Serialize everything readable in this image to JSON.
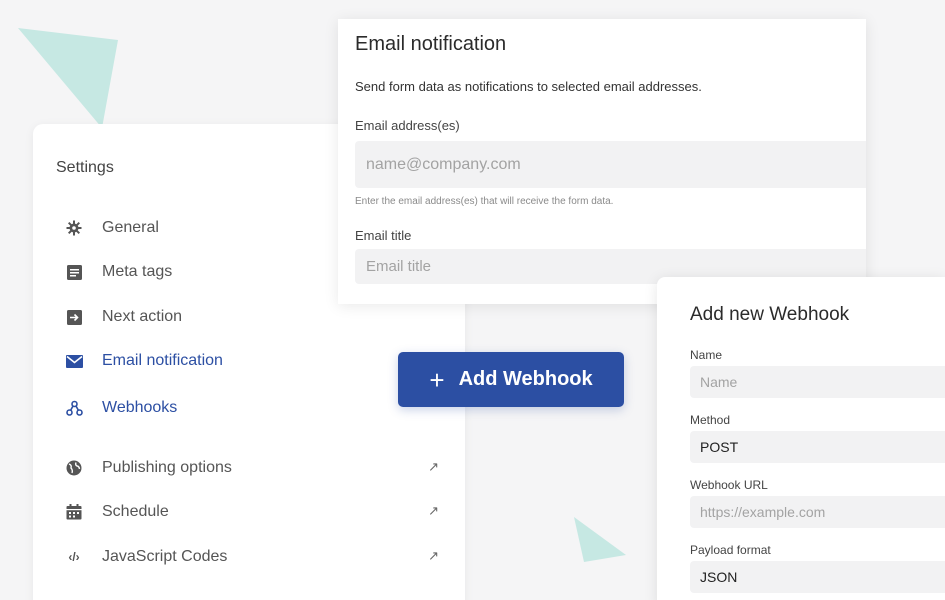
{
  "settings": {
    "title": "Settings",
    "items": [
      {
        "label": "General",
        "icon": "gear-icon"
      },
      {
        "label": "Meta tags",
        "icon": "document-icon"
      },
      {
        "label": "Next action",
        "icon": "arrow-right-box-icon"
      },
      {
        "label": "Email notification",
        "icon": "envelope-icon",
        "active": true
      },
      {
        "label": "Webhooks",
        "icon": "webhook-icon",
        "active": true
      },
      {
        "label": "Publishing options",
        "icon": "globe-icon",
        "external": "↗"
      },
      {
        "label": "Schedule",
        "icon": "calendar-icon",
        "external": "↗"
      },
      {
        "label": "JavaScript Codes",
        "icon": "code-icon",
        "icon_text": "‹/›",
        "external": "↗"
      }
    ]
  },
  "email": {
    "title": "Email notification",
    "description": "Send form data as notifications to selected email addresses.",
    "address_label": "Email address(es)",
    "address_placeholder": "name@company.com",
    "address_hint": "Enter the email address(es) that will receive the form data.",
    "title_label": "Email title",
    "title_placeholder": "Email title"
  },
  "add_button": {
    "plus": "+",
    "label": "Add Webhook"
  },
  "webhook": {
    "title": "Add new Webhook",
    "name_label": "Name",
    "name_placeholder": "Name",
    "method_label": "Method",
    "method_value": "POST",
    "url_label": "Webhook URL",
    "url_placeholder": "https://example.com",
    "payload_label": "Payload format",
    "payload_value": "JSON"
  },
  "colors": {
    "accent": "#2c4fa3",
    "decor_teal": "#c6e8e3",
    "background": "#f5f5f6"
  }
}
